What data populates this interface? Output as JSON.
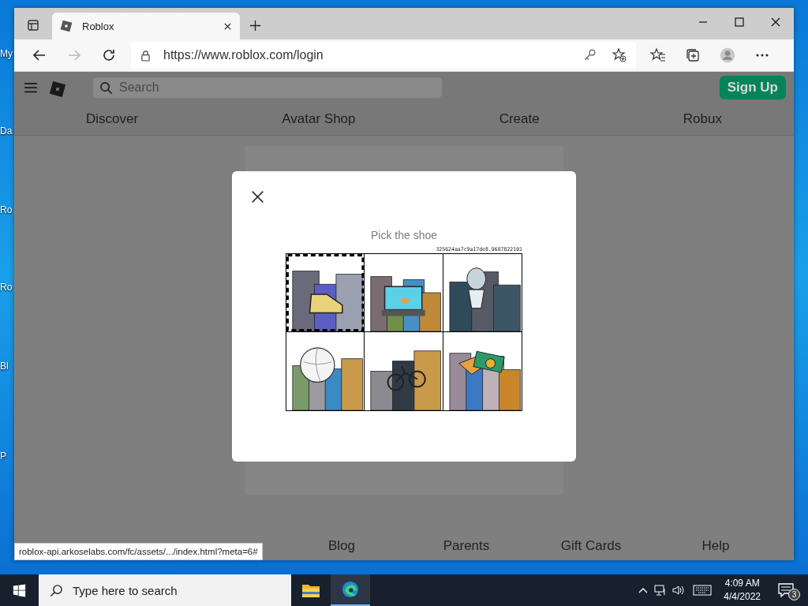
{
  "desktop_icons": [
    {
      "label": "My"
    },
    {
      "label": "Da"
    },
    {
      "label": "Ro"
    },
    {
      "label": "Ro"
    },
    {
      "label": "Bl"
    },
    {
      "label": "P"
    }
  ],
  "browser": {
    "tab": {
      "title": "Roblox"
    },
    "address": "https://www.roblox.com/login"
  },
  "page": {
    "search": {
      "placeholder": "Search"
    },
    "sign_up": "Sign Up",
    "nav": [
      "Discover",
      "Avatar Shop",
      "Create",
      "Robux"
    ],
    "footer": [
      "Blog",
      "Parents",
      "Gift Cards",
      "Help"
    ]
  },
  "captcha": {
    "prompt": "Pick the shoe",
    "token": "325624aa7c9a17de8.9687822101",
    "tiles": [
      {
        "kind": "picture",
        "selected": true
      },
      {
        "kind": "picture",
        "selected": false
      },
      {
        "kind": "picture",
        "selected": false
      },
      {
        "kind": "picture",
        "selected": false
      },
      {
        "kind": "picture",
        "selected": false
      },
      {
        "kind": "picture",
        "selected": false
      }
    ]
  },
  "status_url": "roblox-api.arkoselabs.com/fc/assets/.../index.html?meta=6#",
  "taskbar": {
    "search": {
      "placeholder": "Type here to search"
    },
    "time": "4:09 AM",
    "date": "4/4/2022",
    "notifications": "3"
  }
}
